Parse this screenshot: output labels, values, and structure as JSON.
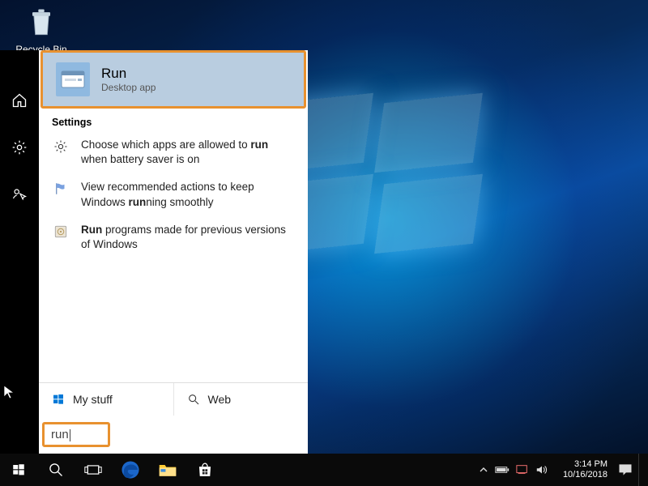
{
  "desktop": {
    "recycle_bin_label": "Recycle Bin"
  },
  "search": {
    "query": "run",
    "top_result": {
      "title": "Run",
      "subtitle": "Desktop app"
    },
    "section_label": "Settings",
    "settings_items": [
      {
        "pre": "Choose which apps are allowed to ",
        "bold": "run",
        "post": " when battery saver is on"
      },
      {
        "pre": "View recommended actions to keep Windows ",
        "bold": "run",
        "post": "ning smoothly"
      },
      {
        "pre": "",
        "bold": "Run",
        "post": " programs made for previous versions of Windows"
      }
    ],
    "scope_mystuff": "My stuff",
    "scope_web": "Web"
  },
  "taskbar": {
    "time": "3:14 PM",
    "date": "10/16/2018"
  }
}
